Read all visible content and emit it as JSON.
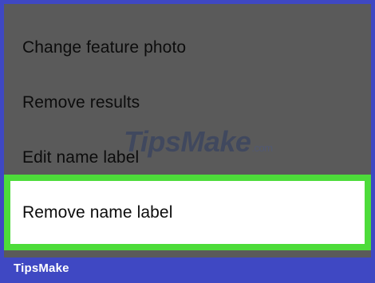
{
  "menu": {
    "items": [
      {
        "label": "Change feature photo"
      },
      {
        "label": "Remove results"
      },
      {
        "label": "Edit name label"
      },
      {
        "label": "Remove name label"
      }
    ],
    "highlighted_index": 3
  },
  "watermark": {
    "text": "TipsMake",
    "suffix": ".com"
  },
  "brand": {
    "text": "TipsMake"
  },
  "colors": {
    "frame_border": "#3f48c3",
    "menu_background": "#5a5a5a",
    "highlight_outline": "#4ddc3a",
    "highlight_fill": "#ffffff",
    "text": "#0c0c0c"
  }
}
